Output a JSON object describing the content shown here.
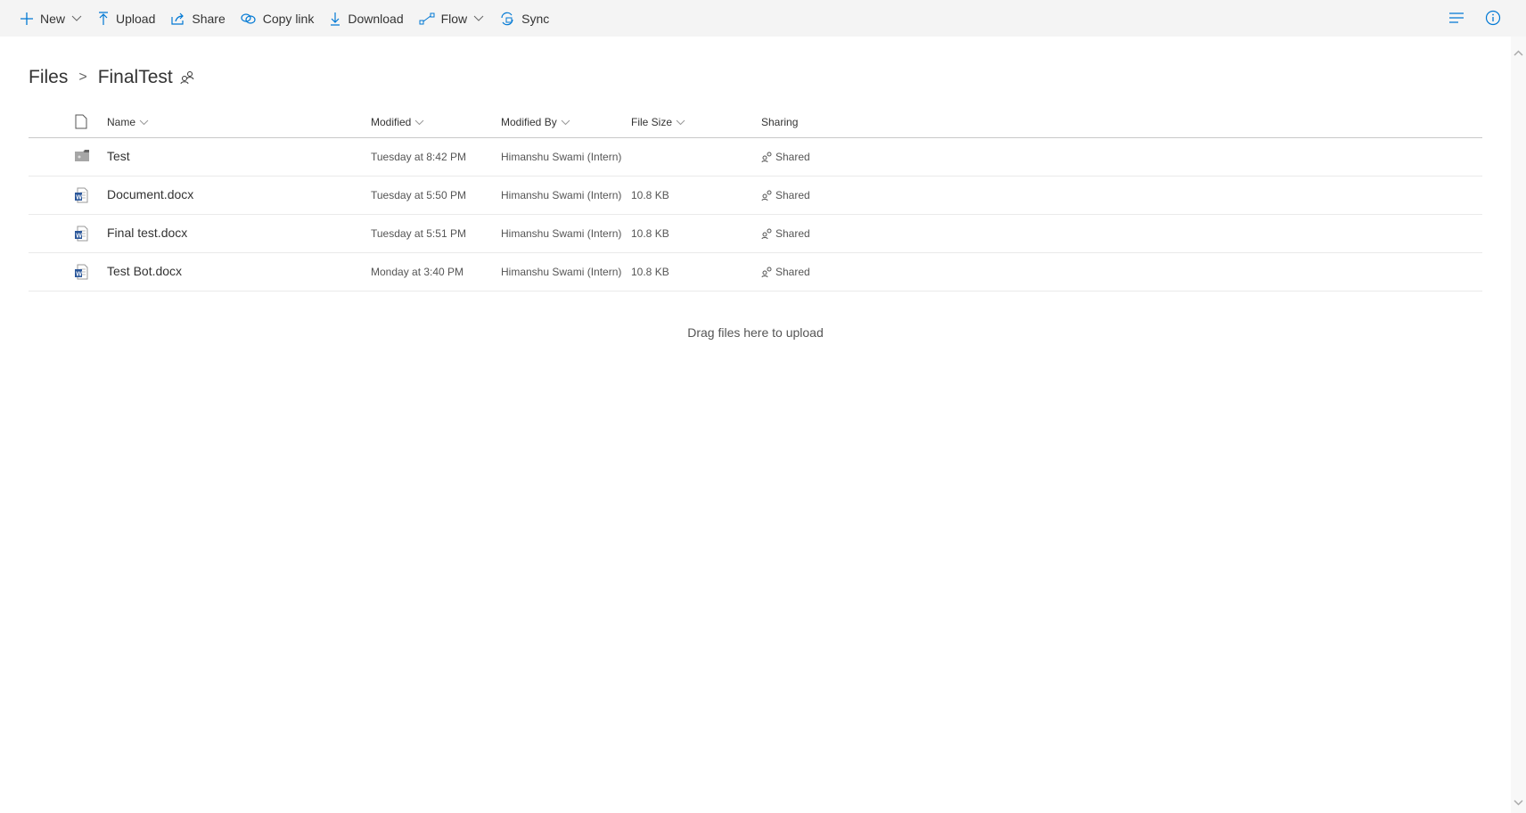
{
  "toolbar": {
    "items": [
      {
        "label": "New",
        "icon": "plus-icon",
        "dropdown": true
      },
      {
        "label": "Upload",
        "icon": "upload-icon"
      },
      {
        "label": "Share",
        "icon": "share-icon"
      },
      {
        "label": "Copy link",
        "icon": "link-icon"
      },
      {
        "label": "Download",
        "icon": "download-icon"
      },
      {
        "label": "Flow",
        "icon": "flow-icon",
        "dropdown": true
      },
      {
        "label": "Sync",
        "icon": "sync-icon"
      }
    ],
    "accent": "#0078d4"
  },
  "breadcrumb": {
    "root": "Files",
    "current": "FinalTest"
  },
  "table": {
    "headers": {
      "name": "Name",
      "modified": "Modified",
      "modified_by": "Modified By",
      "file_size": "File Size",
      "sharing": "Sharing"
    },
    "rows": [
      {
        "type": "folder",
        "name": "Test",
        "modified": "Tuesday at 8:42 PM",
        "modified_by": "Himanshu Swami (Intern)",
        "file_size": "",
        "sharing": "Shared"
      },
      {
        "type": "word",
        "name": "Document.docx",
        "modified": "Tuesday at 5:50 PM",
        "modified_by": "Himanshu Swami (Intern)",
        "file_size": "10.8 KB",
        "sharing": "Shared"
      },
      {
        "type": "word",
        "name": "Final test.docx",
        "modified": "Tuesday at 5:51 PM",
        "modified_by": "Himanshu Swami (Intern)",
        "file_size": "10.8 KB",
        "sharing": "Shared"
      },
      {
        "type": "word",
        "name": "Test Bot.docx",
        "modified": "Monday at 3:40 PM",
        "modified_by": "Himanshu Swami (Intern)",
        "file_size": "10.8 KB",
        "sharing": "Shared"
      }
    ]
  },
  "drop_hint": "Drag files here to upload"
}
